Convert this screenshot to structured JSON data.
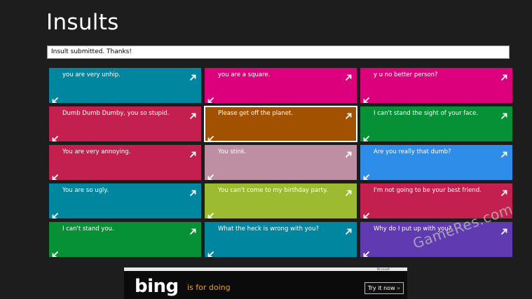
{
  "app": {
    "title": "Insults"
  },
  "status": {
    "message": "Insult submitted. Thanks!"
  },
  "tiles": [
    {
      "text": "you are very unhip.",
      "color": "#00869e"
    },
    {
      "text": "you are a square.",
      "color": "#dc007d"
    },
    {
      "text": "y u no better person?",
      "color": "#dc007d"
    },
    {
      "text": "Dumb Dumb Dumby, you so stupid.",
      "color": "#c31f4f"
    },
    {
      "text": "Please get off the planet.",
      "color": "#a25100",
      "selected": true
    },
    {
      "text": "I can't stand the sight of your face.",
      "color": "#069136"
    },
    {
      "text": "You are very annoying.",
      "color": "#c31f4f"
    },
    {
      "text": "You stink.",
      "color": "#be8ea2"
    },
    {
      "text": "Are you really that dumb?",
      "color": "#2e8de8"
    },
    {
      "text": "You are so ugly.",
      "color": "#00869e"
    },
    {
      "text": "You can't come to my birthday party.",
      "color": "#9dbb30"
    },
    {
      "text": "I'm not going to be your best friend.",
      "color": "#c31f4f"
    },
    {
      "text": "I can't stand you.",
      "color": "#069136"
    },
    {
      "text": "What the heck is wrong with you?",
      "color": "#00869e"
    },
    {
      "text": "Why do I put up with you?",
      "color": "#5f3ab1"
    }
  ],
  "ad": {
    "brand": "bing",
    "tagline": "is for doing",
    "cta": "Try it now",
    "cta_chevron": "»",
    "sponsor": "Microsoft"
  },
  "watermark": "GameRes.com"
}
